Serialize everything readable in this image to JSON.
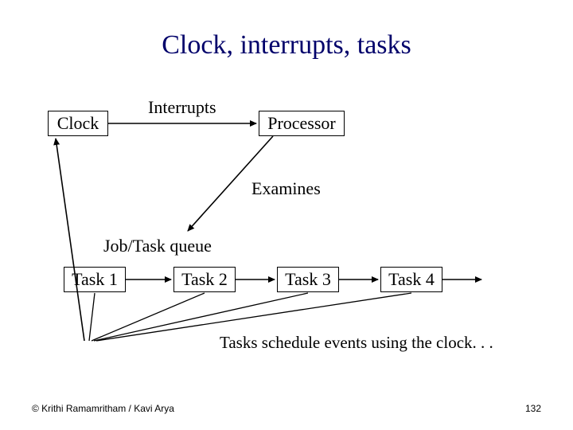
{
  "title": "Clock, interrupts, tasks",
  "boxes": {
    "clock": "Clock",
    "processor": "Processor",
    "task1": "Task 1",
    "task2": "Task 2",
    "task3": "Task 3",
    "task4": "Task 4"
  },
  "labels": {
    "interrupts": "Interrupts",
    "examines": "Examines",
    "jobtask": "Job/Task queue",
    "note": "Tasks schedule events using the clock. . ."
  },
  "footer": {
    "credit": "© Krithi Ramamritham / Kavi Arya",
    "page": "132"
  }
}
